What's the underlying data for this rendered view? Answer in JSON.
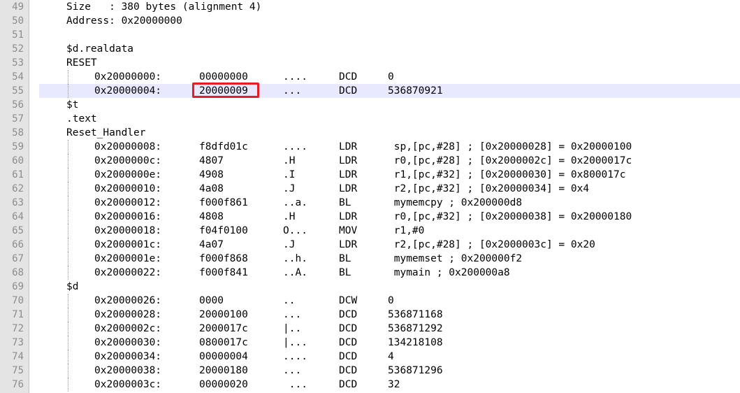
{
  "colors": {
    "gutter_bg": "#e4e4e4",
    "current_line_bg": "#e8e8ff",
    "highlight_box": "#e81c24",
    "line_number": "#8c8c8c"
  },
  "highlighted_value_line": "55",
  "lines": [
    {
      "n": "49",
      "text": "Size   : 380 bytes (alignment 4)"
    },
    {
      "n": "50",
      "text": "Address: 0x20000000"
    },
    {
      "n": "51"
    },
    {
      "n": "52",
      "text": "$d.realdata"
    },
    {
      "n": "53",
      "text": "RESET"
    },
    {
      "n": "54",
      "addr": "0x20000000:",
      "hex": "00000000",
      "ascii": "....",
      "op": "DCD",
      "arg": "0"
    },
    {
      "n": "55",
      "addr": "0x20000004:",
      "hex": "20000009",
      "ascii": "...",
      "op": "DCD",
      "arg": "536870921",
      "current": true
    },
    {
      "n": "56",
      "text": "$t"
    },
    {
      "n": "57",
      "text": ".text"
    },
    {
      "n": "58",
      "text": "Reset_Handler"
    },
    {
      "n": "59",
      "addr": "0x20000008:",
      "hex": "f8dfd01c",
      "ascii": "....",
      "op": "LDR",
      "arg": " sp,[pc,#28] ; [0x20000028] = 0x20000100"
    },
    {
      "n": "60",
      "addr": "0x2000000c:",
      "hex": "4807",
      "ascii": ".H",
      "op": "LDR",
      "arg": " r0,[pc,#28] ; [0x2000002c] = 0x2000017c"
    },
    {
      "n": "61",
      "addr": "0x2000000e:",
      "hex": "4908",
      "ascii": ".I",
      "op": "LDR",
      "arg": " r1,[pc,#32] ; [0x20000030] = 0x800017c"
    },
    {
      "n": "62",
      "addr": "0x20000010:",
      "hex": "4a08",
      "ascii": ".J",
      "op": "LDR",
      "arg": " r2,[pc,#32] ; [0x20000034] = 0x4"
    },
    {
      "n": "63",
      "addr": "0x20000012:",
      "hex": "f000f861",
      "ascii": "..a.",
      "op": "BL",
      "arg": " mymemcpy ; 0x200000d8"
    },
    {
      "n": "64",
      "addr": "0x20000016:",
      "hex": "4808",
      "ascii": ".H",
      "op": "LDR",
      "arg": " r0,[pc,#32] ; [0x20000038] = 0x20000180"
    },
    {
      "n": "65",
      "addr": "0x20000018:",
      "hex": "f04f0100",
      "ascii": "O...",
      "op": "MOV",
      "arg": " r1,#0"
    },
    {
      "n": "66",
      "addr": "0x2000001c:",
      "hex": "4a07",
      "ascii": ".J",
      "op": "LDR",
      "arg": " r2,[pc,#28] ; [0x2000003c] = 0x20"
    },
    {
      "n": "67",
      "addr": "0x2000001e:",
      "hex": "f000f868",
      "ascii": "..h.",
      "op": "BL",
      "arg": " mymemset ; 0x200000f2"
    },
    {
      "n": "68",
      "addr": "0x20000022:",
      "hex": "f000f841",
      "ascii": "..A.",
      "op": "BL",
      "arg": " mymain ; 0x200000a8"
    },
    {
      "n": "69",
      "text": "$d"
    },
    {
      "n": "70",
      "addr": "0x20000026:",
      "hex": "0000",
      "ascii": "..",
      "op": "DCW",
      "arg": "0"
    },
    {
      "n": "71",
      "addr": "0x20000028:",
      "hex": "20000100",
      "ascii": "...",
      "op": "DCD",
      "arg": "536871168"
    },
    {
      "n": "72",
      "addr": "0x2000002c:",
      "hex": "2000017c",
      "ascii": "|..",
      "op": "DCD",
      "arg": "536871292"
    },
    {
      "n": "73",
      "addr": "0x20000030:",
      "hex": "0800017c",
      "ascii": "|...",
      "op": "DCD",
      "arg": "134218108"
    },
    {
      "n": "74",
      "addr": "0x20000034:",
      "hex": "00000004",
      "ascii": "....",
      "op": "DCD",
      "arg": "4"
    },
    {
      "n": "75",
      "addr": "0x20000038:",
      "hex": "20000180",
      "ascii": "...",
      "op": "DCD",
      "arg": "536871296"
    },
    {
      "n": "76",
      "addr": "0x2000003c:",
      "hex": "00000020",
      "ascii": " ...",
      "op": "DCD",
      "arg": "32"
    }
  ]
}
